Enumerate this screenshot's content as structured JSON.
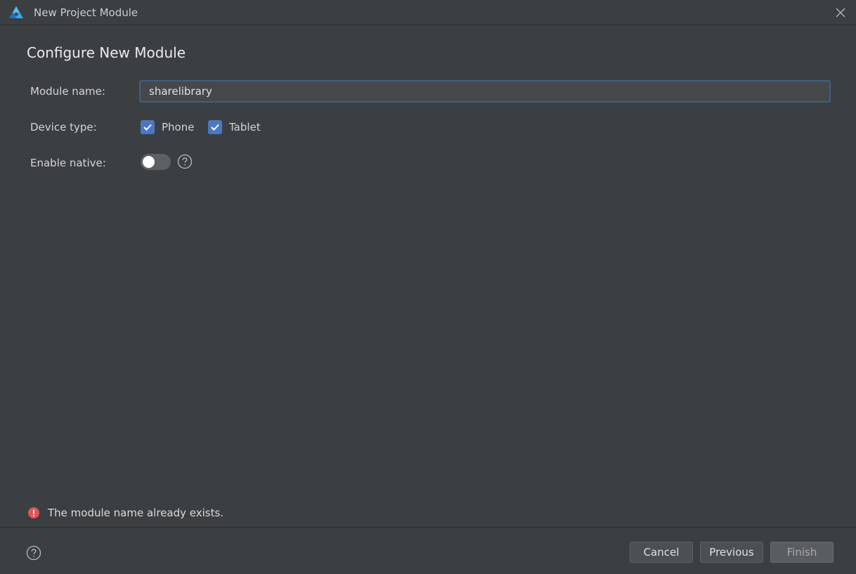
{
  "window": {
    "title": "New Project Module",
    "close_icon": "close-icon",
    "logo_icon": "app-logo-icon"
  },
  "page": {
    "title": "Configure New Module"
  },
  "form": {
    "module_name": {
      "label": "Module name:",
      "value": "sharelibrary"
    },
    "device_type": {
      "label": "Device type:",
      "options": [
        {
          "label": "Phone",
          "checked": true
        },
        {
          "label": "Tablet",
          "checked": true
        }
      ]
    },
    "enable_native": {
      "label": "Enable native:",
      "enabled": false,
      "help_icon": "help-icon"
    }
  },
  "error": {
    "icon": "error-icon",
    "message": "The module name already exists."
  },
  "footer": {
    "help_icon": "help-icon",
    "buttons": {
      "cancel": "Cancel",
      "previous": "Previous",
      "finish": "Finish"
    }
  },
  "colors": {
    "background": "#3c3f41",
    "accent": "#4a78c2",
    "input_focus": "#3d6185",
    "error": "#e0555a"
  }
}
